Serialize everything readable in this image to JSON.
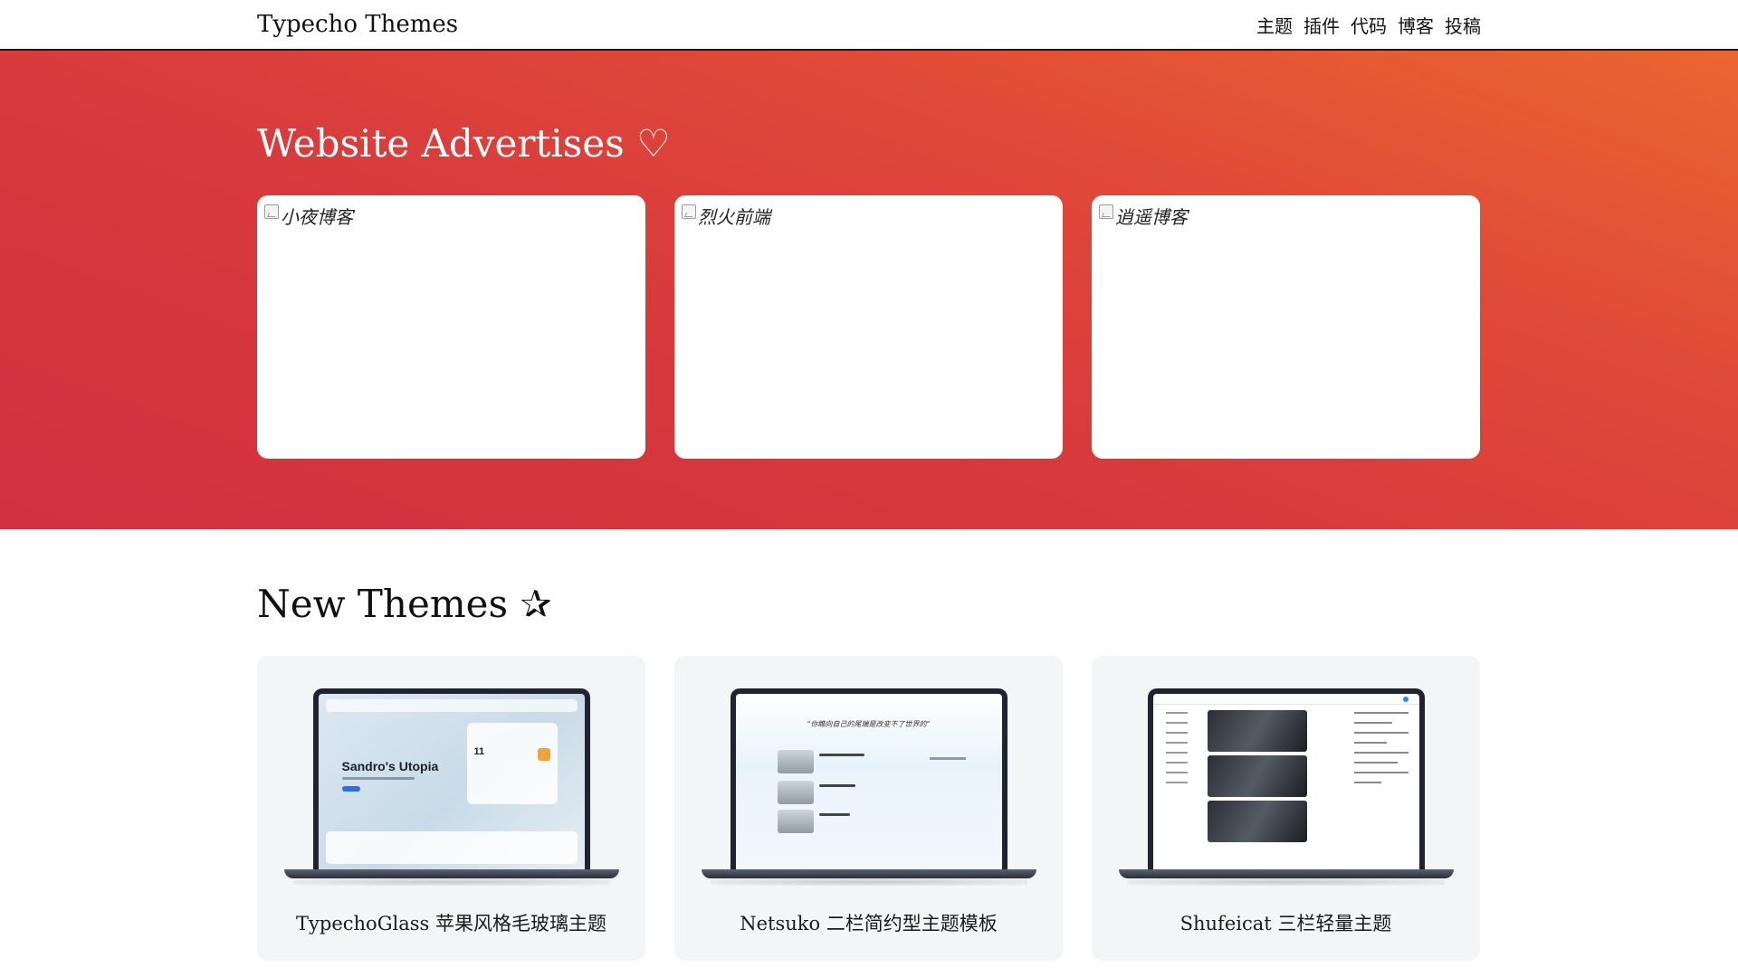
{
  "nav": {
    "brand": "Typecho Themes",
    "links": [
      "主题",
      "插件",
      "代码",
      "博客",
      "投稿"
    ]
  },
  "hero": {
    "title": "Website Advertises ♡",
    "ads": [
      {
        "alt": "小夜博客"
      },
      {
        "alt": "烈火前端"
      },
      {
        "alt": "逍遥博客"
      }
    ]
  },
  "themes": {
    "title": "New Themes ✰",
    "items": [
      {
        "name": "TypechoGlass 苹果风格毛玻璃主题",
        "preview_heading": "Sandro's Utopia",
        "preview_value": "11"
      },
      {
        "name": "Netsuko 二栏简约型主题模板",
        "preview_quote": "“你瞧向自己的尾端是改变不了世界的”"
      },
      {
        "name": "Shufeicat 三栏轻量主题"
      }
    ]
  },
  "colors": {
    "hero_gradient_start": "#ea6630",
    "hero_gradient_end": "#d13240"
  }
}
